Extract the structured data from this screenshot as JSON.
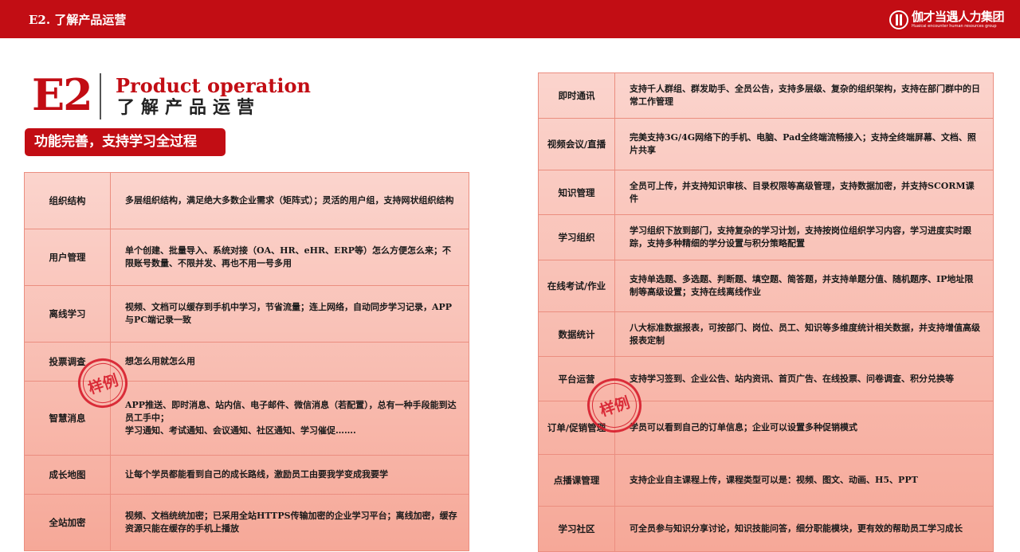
{
  "header": {
    "title": "E2. 了解产品运营",
    "logo_cn": "伽才当遇人力集团",
    "logo_en": "Huaicai encounter human resources group"
  },
  "heading": {
    "code": "E2",
    "title_en": "Product operation",
    "title_cn": "了解产品运营",
    "subtitle": "功能完善，支持学习全过程"
  },
  "stamp": {
    "text": "样例"
  },
  "colors": {
    "brand_red": "#c20d14",
    "cell_top": "#fbd4cd",
    "cell_bottom": "#f6a898",
    "stamp": "#d71d2c"
  },
  "left_features": [
    {
      "name": "组织结构",
      "desc": "多层组织结构，满足绝大多数企业需求（矩阵式）；灵活的用户组，支持网状组织结构"
    },
    {
      "name": "用户管理",
      "desc": "单个创建、批量导入、系统对接（OA、HR、eHR、ERP等）怎么方便怎么来；不限账号数量、不限并发、再也不用一号多用"
    },
    {
      "name": "离线学习",
      "desc": "视频、文档可以缓存到手机中学习，节省流量；连上网络，自动同步学习记录，APP与PC端记录一致"
    },
    {
      "name": "投票调查",
      "desc": "想怎么用就怎么用"
    },
    {
      "name": "智慧消息",
      "desc": "APP推送、即时消息、站内信、电子邮件、微信消息（若配置），总有一种手段能到达员工手中；\n学习通知、考试通知、会议通知、社区通知、学习催促……."
    },
    {
      "name": "成长地图",
      "desc": "让每个学员都能看到自己的成长路线，激励员工由要我学变成我要学"
    },
    {
      "name": "全站加密",
      "desc": "视频、文档统统加密；已采用全站HTTPS传输加密的企业学习平台；离线加密，缓存资源只能在缓存的手机上播放"
    }
  ],
  "right_features": [
    {
      "name": "即时通讯",
      "desc": "支持千人群组、群发助手、全员公告，支持多层级、复杂的组织架构，支持在部门群中的日常工作管理"
    },
    {
      "name": "视频会议/直播",
      "desc": "完美支持3G/4G网络下的手机、电脑、Pad全终端流畅接入；支持全终端屏幕、文档、照片共享"
    },
    {
      "name": "知识管理",
      "desc": "全员可上传，并支持知识审核、目录权限等高级管理，支持数据加密，并支持SCORM课件"
    },
    {
      "name": "学习组织",
      "desc": "学习组织下放到部门，支持复杂的学习计划，支持按岗位组织学习内容，学习进度实时跟踪，支持多种精细的学分设置与积分策略配置"
    },
    {
      "name": "在线考试/作业",
      "desc": "支持单选题、多选题、判断题、填空题、简答题，并支持单题分值、随机题序、IP地址限制等高级设置；支持在线离线作业"
    },
    {
      "name": "数据统计",
      "desc": "八大标准数据报表，可按部门、岗位、员工、知识等多维度统计相关数据，并支持增值高级报表定制"
    },
    {
      "name": "平台运营",
      "desc": "支持学习签到、企业公告、站内资讯、首页广告、在线投票、问卷调查、积分兑换等"
    },
    {
      "name": "订单/促销管理",
      "desc": "学员可以看到自己的订单信息；企业可以设置多种促销模式"
    },
    {
      "name": "点播课管理",
      "desc": "支持企业自主课程上传，课程类型可以是：视频、图文、动画、H5、PPT"
    },
    {
      "name": "学习社区",
      "desc": "可全员参与知识分享讨论，知识技能问答，细分职能模块，更有效的帮助员工学习成长"
    }
  ]
}
